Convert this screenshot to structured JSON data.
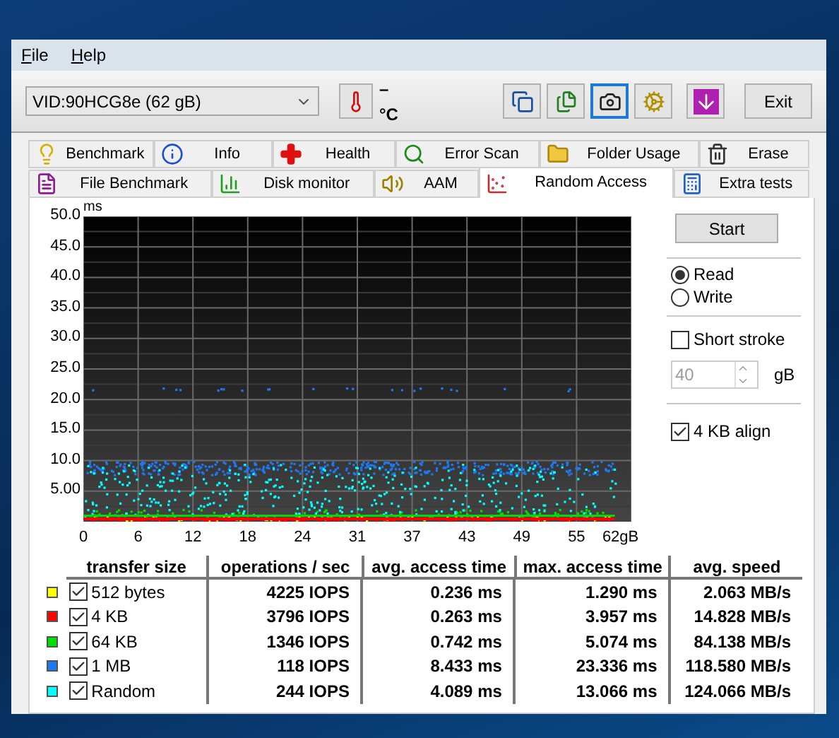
{
  "menu": [
    {
      "label": "File"
    },
    {
      "label": "Help"
    }
  ],
  "drive_select": {
    "value": "VID:90HCG8e (62 gB)"
  },
  "temperature": "– °C",
  "toolbar_buttons": [
    {
      "kind": "copy-text",
      "selected": false
    },
    {
      "kind": "copy-image",
      "selected": false
    },
    {
      "kind": "camera",
      "selected": true
    },
    {
      "kind": "options",
      "selected": false
    },
    {
      "kind": "download",
      "selected": false
    }
  ],
  "exit_button": "Exit",
  "tabs_top": [
    {
      "kind": "bulb",
      "label": "Benchmark",
      "selected": false
    },
    {
      "kind": "info",
      "label": "Info",
      "selected": false
    },
    {
      "kind": "health",
      "label": "Health",
      "selected": false
    },
    {
      "kind": "scan",
      "label": "Error Scan",
      "selected": false
    },
    {
      "kind": "folder",
      "label": "Folder Usage",
      "selected": false
    },
    {
      "kind": "trash",
      "label": "Erase",
      "selected": false
    }
  ],
  "tabs_bottom": [
    {
      "kind": "file",
      "label": "File Benchmark",
      "selected": false
    },
    {
      "kind": "monitor",
      "label": "Disk monitor",
      "selected": false
    },
    {
      "kind": "speaker",
      "label": "AAM",
      "selected": false
    },
    {
      "kind": "scatter",
      "label": "Random Access",
      "selected": true
    },
    {
      "kind": "table",
      "label": "Extra tests",
      "selected": false
    }
  ],
  "chart": {
    "y_unit": "ms",
    "y_ticks": [
      "50.0",
      "45.0",
      "40.0",
      "35.0",
      "30.0",
      "25.0",
      "20.0",
      "15.0",
      "10.0",
      "5.00"
    ],
    "x_ticks": [
      "0",
      "6",
      "12",
      "18",
      "24",
      "31",
      "37",
      "43",
      "49",
      "55",
      "62gB"
    ]
  },
  "start_button": "Start",
  "mode": [
    {
      "label": "Read",
      "selected": true
    },
    {
      "label": "Write",
      "selected": false
    }
  ],
  "short_stroke": {
    "label": "Short stroke",
    "checked": false,
    "value": "40",
    "unit": "gB"
  },
  "align": {
    "label": "4 KB align",
    "checked": true
  },
  "results": {
    "columns": [
      "transfer size",
      "operations / sec",
      "avg. access time",
      "max. access time",
      "avg. speed"
    ],
    "rows": [
      {
        "color": "#ffff00",
        "checked": true,
        "transfer_size": "512 bytes",
        "operations": "4225 IOPS",
        "avg_access": "0.236 ms",
        "max_access": "1.290 ms",
        "speed": "2.063 MB/s"
      },
      {
        "color": "#ff0000",
        "checked": true,
        "transfer_size": "4 KB",
        "operations": "3796 IOPS",
        "avg_access": "0.263 ms",
        "max_access": "3.957 ms",
        "speed": "14.828 MB/s"
      },
      {
        "color": "#00dd00",
        "checked": true,
        "transfer_size": "64 KB",
        "operations": "1346 IOPS",
        "avg_access": "0.742 ms",
        "max_access": "5.074 ms",
        "speed": "84.138 MB/s"
      },
      {
        "color": "#1e78f0",
        "checked": true,
        "transfer_size": "1 MB",
        "operations": "118 IOPS",
        "avg_access": "8.433 ms",
        "max_access": "23.336 ms",
        "speed": "118.580 MB/s"
      },
      {
        "color": "#00ffff",
        "checked": true,
        "transfer_size": "Random",
        "operations": "244 IOPS",
        "avg_access": "4.089 ms",
        "max_access": "13.066 ms",
        "speed": "124.066 MB/s"
      }
    ]
  }
}
